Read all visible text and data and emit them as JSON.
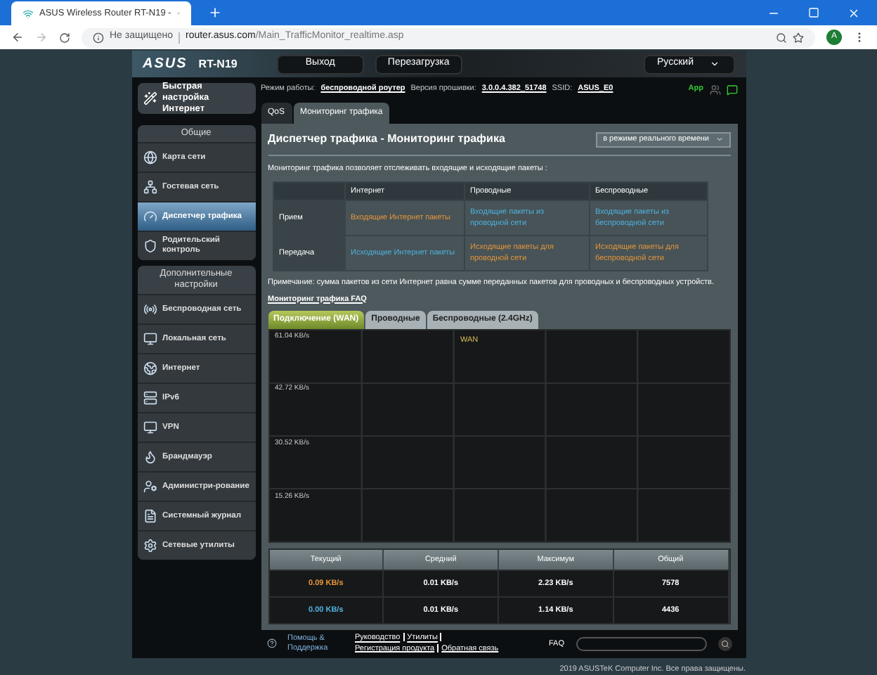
{
  "browser": {
    "tab_title": "ASUS Wireless Router RT-N19 - ",
    "security": "Не защищено",
    "url_host": "router.asus.com",
    "url_path": "/Main_TrafficMonitor_realtime.asp",
    "avatar": "A"
  },
  "header": {
    "logo": "ASUS",
    "model": "RT-N19",
    "buttons": [
      "Выход",
      "Перезагрузка"
    ],
    "language": "Русский"
  },
  "info": {
    "mode_label": "Режим работы:",
    "mode": "беспроводной роутер",
    "fw_label": "Версия прошивки:",
    "fw": "3.0.0.4.382_51748",
    "ssid_label": "SSID:",
    "ssid": "ASUS_E0",
    "app": "App"
  },
  "sidebar": {
    "quick": "Быстрая настройка Интернет",
    "sections": [
      {
        "title": "Общие",
        "items": [
          {
            "label": "Карта сети",
            "selected": false
          },
          {
            "label": "Гостевая сеть",
            "selected": false
          },
          {
            "label": "Диспетчер трафика",
            "selected": true
          },
          {
            "label": "Родительский контроль",
            "selected": false
          }
        ]
      },
      {
        "title": "Дополнительные настройки",
        "items": [
          {
            "label": "Беспроводная сеть",
            "selected": false
          },
          {
            "label": "Локальная сеть",
            "selected": false
          },
          {
            "label": "Интернет",
            "selected": false
          },
          {
            "label": "IPv6",
            "selected": false
          },
          {
            "label": "VPN",
            "selected": false
          },
          {
            "label": "Брандмауэр",
            "selected": false
          },
          {
            "label": "Администри-рование",
            "selected": false
          },
          {
            "label": "Системный журнал",
            "selected": false
          },
          {
            "label": "Сетевые утилиты",
            "selected": false
          }
        ]
      }
    ]
  },
  "tabs": [
    {
      "label": "QoS",
      "selected": false
    },
    {
      "label": "Мониторинг трафика",
      "selected": true
    }
  ],
  "panel": {
    "title": "Диспетчер трафика - Мониторинг трафика",
    "mode_select": "в режиме реального времени",
    "description": "Мониторинг трафика позволяет отслеживать входящие и исходящие пакеты :",
    "table": {
      "columns": [
        "Интернет",
        "Проводные",
        "Беспроводные"
      ],
      "rows": [
        {
          "label": "Прием",
          "cells": [
            {
              "text": "Входящие Интернет пакеты",
              "color": "#e8963a"
            },
            {
              "text": "Входящие пакеты из проводной сети",
              "color": "#4fb3e0"
            },
            {
              "text": "Входящие пакеты из беспроводной сети",
              "color": "#4fb3e0"
            }
          ]
        },
        {
          "label": "Передача",
          "cells": [
            {
              "text": "Исходящие Интернет пакеты",
              "color": "#4fb3e0"
            },
            {
              "text": "Исходящие пакеты для проводной сети",
              "color": "#e8963a"
            },
            {
              "text": "Исходящие пакеты для беспроводной сети",
              "color": "#e8963a"
            }
          ]
        }
      ]
    },
    "note": "Примечание: сумма пакетов из сети Интернет равна сумме переданных пакетов для проводных и беспроводных устройств.",
    "faq_link": "Мониторинг трафика FAQ",
    "graph_tabs": [
      {
        "label": "Подключение (WAN)",
        "selected": true
      },
      {
        "label": "Проводные",
        "selected": false
      },
      {
        "label": "Беспроводные (2.4GHz)",
        "selected": false
      }
    ],
    "graph": {
      "legend": "WAN",
      "y_labels": [
        "61.04 KB/s",
        "42.72 KB/s",
        "30.52 KB/s",
        "15.26 KB/s"
      ]
    },
    "stats": {
      "columns": [
        "Текущий",
        "Средний",
        "Максимум",
        "Общий"
      ],
      "rows": [
        {
          "color": "#e8963a",
          "values": [
            "0.09 KB/s",
            "0.01 KB/s",
            "2.23 KB/s",
            "7578"
          ]
        },
        {
          "color": "#4fb3e0",
          "values": [
            "0.00 KB/s",
            "0.01 KB/s",
            "1.14 KB/s",
            "4436"
          ]
        }
      ]
    }
  },
  "footer": {
    "help": "Помощь & Поддержка",
    "links": [
      "Руководство",
      "Утилиты",
      "Регистрация продукта",
      "Обратная связь"
    ],
    "faq": "FAQ",
    "copyright": "2019 ASUSTeK Computer Inc. Все права защищены."
  }
}
